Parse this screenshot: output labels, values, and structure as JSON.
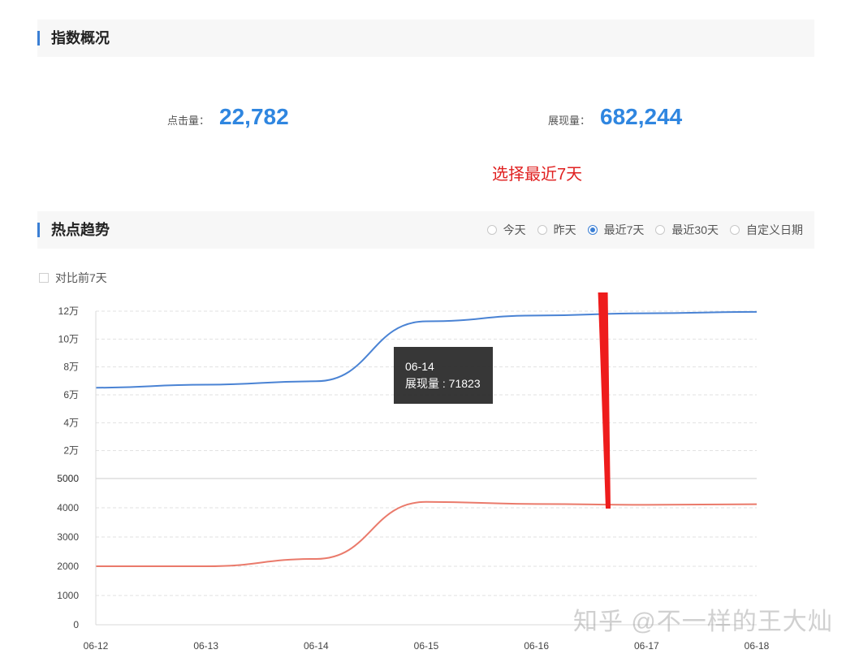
{
  "overview": {
    "title": "指数概况"
  },
  "stats": {
    "clicks": {
      "label": "点击量：",
      "value": "22,782"
    },
    "impressions": {
      "label": "展现量：",
      "value": "682,244"
    }
  },
  "annotation": {
    "text": "选择最近7天"
  },
  "trend": {
    "title": "热点趋势",
    "ranges": [
      {
        "label": "今天",
        "selected": false
      },
      {
        "label": "昨天",
        "selected": false
      },
      {
        "label": "最近7天",
        "selected": true
      },
      {
        "label": "最近30天",
        "selected": false
      },
      {
        "label": "自定义日期",
        "selected": false
      }
    ],
    "compare_label": "对比前7天"
  },
  "tooltip": {
    "date": "06-14",
    "text": "展现量 : 71823"
  },
  "watermark": {
    "text": "知乎 @不一样的王大灿"
  },
  "colors": {
    "impressions": "#4a83d4",
    "clicks": "#ea7a6b",
    "accent": "#2f86e0",
    "annotation": "#e02020"
  },
  "chart_data": {
    "type": "line",
    "x": [
      "06-12",
      "06-13",
      "06-14",
      "06-15",
      "06-16",
      "06-17",
      "06-18"
    ],
    "panels": [
      {
        "yticks": [
          "12万",
          "10万",
          "8万",
          "6万",
          "4万",
          "2万",
          "5000"
        ],
        "ylim": [
          5000,
          120000
        ],
        "series": [
          {
            "values": [
              67400,
              69500,
              71823,
              113000,
              117000,
              118500,
              119500
            ],
            "color": "#4a83d4"
          }
        ]
      },
      {
        "yticks": [
          "5000",
          "4000",
          "3000",
          "2000",
          "1000",
          "0"
        ],
        "ylim": [
          0,
          5000
        ],
        "series": [
          {
            "values": [
              2000,
              2000,
              2250,
              4200,
              4130,
              4100,
              4120
            ],
            "color": "#ea7a6b"
          }
        ]
      }
    ]
  }
}
